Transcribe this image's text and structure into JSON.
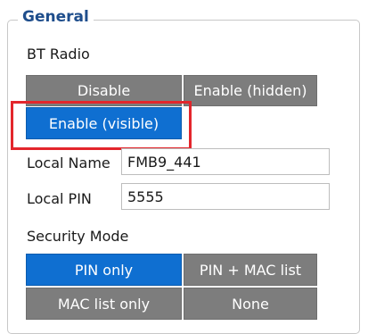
{
  "group": {
    "title": "General"
  },
  "bt_radio": {
    "label": "BT Radio",
    "options": {
      "disable": "Disable",
      "enable_hidden": "Enable (hidden)",
      "enable_visible": "Enable (visible)"
    },
    "selected": "enable_visible"
  },
  "local_name": {
    "label": "Local Name",
    "value": "FMB9_441"
  },
  "local_pin": {
    "label": "Local PIN",
    "value": "5555"
  },
  "security_mode": {
    "label": "Security Mode",
    "options": {
      "pin_only": "PIN only",
      "pin_mac_list": "PIN + MAC list",
      "mac_list_only": "MAC list only",
      "none": "None"
    },
    "selected": "pin_only"
  },
  "colors": {
    "selected": "#0f6fd1",
    "unselected": "#7d7d7d",
    "highlight": "#e3262c",
    "legend": "#1f4e8c"
  }
}
